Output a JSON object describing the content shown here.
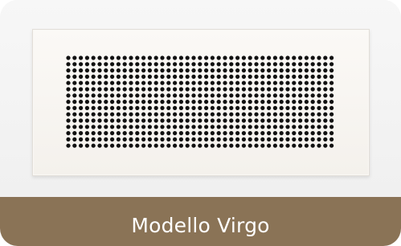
{
  "product": {
    "name": "Modello Virgo",
    "image_icon": "perforated-grille-icon"
  },
  "colors": {
    "background": "#f2f2f2",
    "grille_face": "#f7f4ef",
    "holes": "#111111",
    "label_bar": "#8a7356",
    "label_text": "#ffffff"
  }
}
